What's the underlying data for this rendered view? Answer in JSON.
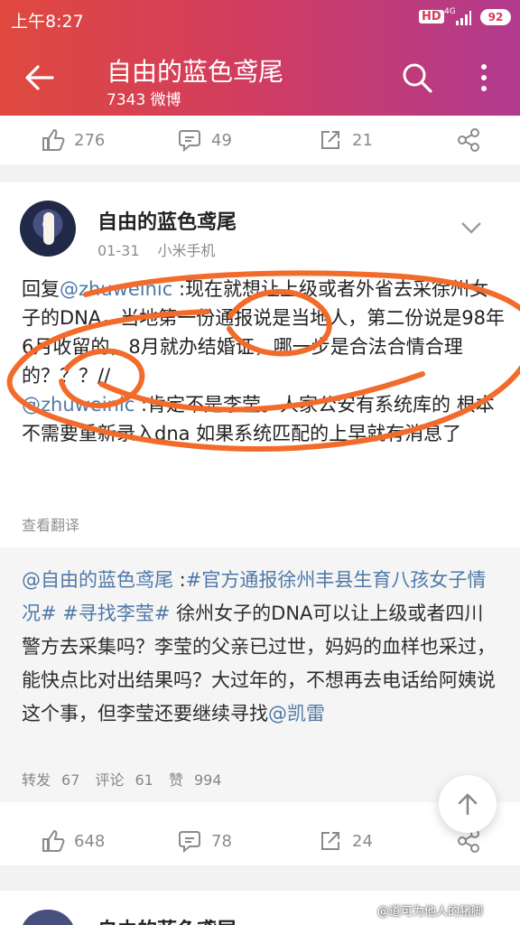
{
  "status_bar": {
    "time": "上午8:27",
    "hd": "HD",
    "network": "4G",
    "battery": "92"
  },
  "header": {
    "title": "自由的蓝色鸢尾",
    "subtitle": "7343 微博"
  },
  "top_actions": {
    "likes": "276",
    "comments": "49",
    "reposts": "21"
  },
  "post": {
    "author": "自由的蓝色鸢尾",
    "date": "01-31",
    "device": "小米手机",
    "reply_prefix": "回复",
    "mention1": "@zhuweinic",
    "text1": " :现在就想让上级或者外省去采徐州女子的DNA，当地第一份通报说是当地人，第二份说是98年6月收留的，8月就办结婚证，哪一步是合法合情合理的？？？//",
    "mention2": "@zhuweinic",
    "text2": " :肯定不是李莹。人家公安有系统库的 根本不需要重新录入dna 如果系统匹配的上早就有消息了",
    "translate": "查看翻译"
  },
  "repost": {
    "mention": "@自由的蓝色鸢尾",
    "separator": " :",
    "tag1": "#官方通报徐州丰县生育八孩女子情况#",
    "tag2": "#寻找李莹#",
    "body": " 徐州女子的DNA可以让上级或者四川警方去采集吗？李莹的父亲已过世，妈妈的血样也采过，能快点比对出结果吗？大过年的，不想再去电话给阿姨说这个事，但李莹还要继续寻找",
    "mention_end": "@凯雷",
    "repost_label": "转发",
    "repost_count": "67",
    "comment_label": "评论",
    "comment_count": "61",
    "like_label": "赞",
    "like_count": "994"
  },
  "bottom_actions": {
    "likes": "648",
    "comments": "78",
    "reposts": "24"
  },
  "next_post": {
    "author": "自由的蓝色鸢尾"
  },
  "watermark": "@道可为他人的猪脚",
  "colors": {
    "header_start": "#e0493e",
    "header_end": "#b13a8e",
    "link": "#4f79a8",
    "annotation": "#f26b2a"
  },
  "icons": [
    "back-arrow-icon",
    "search-icon",
    "more-vertical-icon",
    "like-icon",
    "comment-icon",
    "repost-icon",
    "share-icon",
    "chevron-down-icon",
    "scroll-top-icon"
  ]
}
